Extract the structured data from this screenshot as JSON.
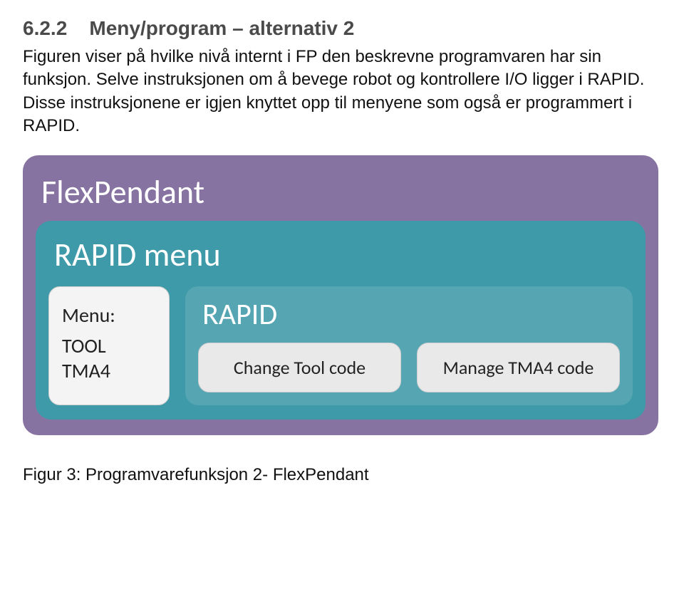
{
  "heading_number": "6.2.2",
  "heading_text": "Meny/program – alternativ 2",
  "paragraph": "Figuren viser på hvilke nivå internt i FP den beskrevne programvaren har sin funksjon. Selve instruksjonen om å bevege robot og kontrollere I/O ligger i RAPID. Disse instruksjonene er igjen knyttet opp til menyene som også er programmert i RAPID.",
  "diagram": {
    "outer_title": "FlexPendant",
    "middle_title": "RAPID menu",
    "menu": {
      "label": "Menu:",
      "items": [
        "TOOL",
        "TMA4"
      ]
    },
    "rapid": {
      "title": "RAPID",
      "boxes": [
        "Change Tool code",
        "Manage TMA4 code"
      ]
    }
  },
  "caption": "Figur 3: Programvarefunksjon 2- FlexPendant"
}
